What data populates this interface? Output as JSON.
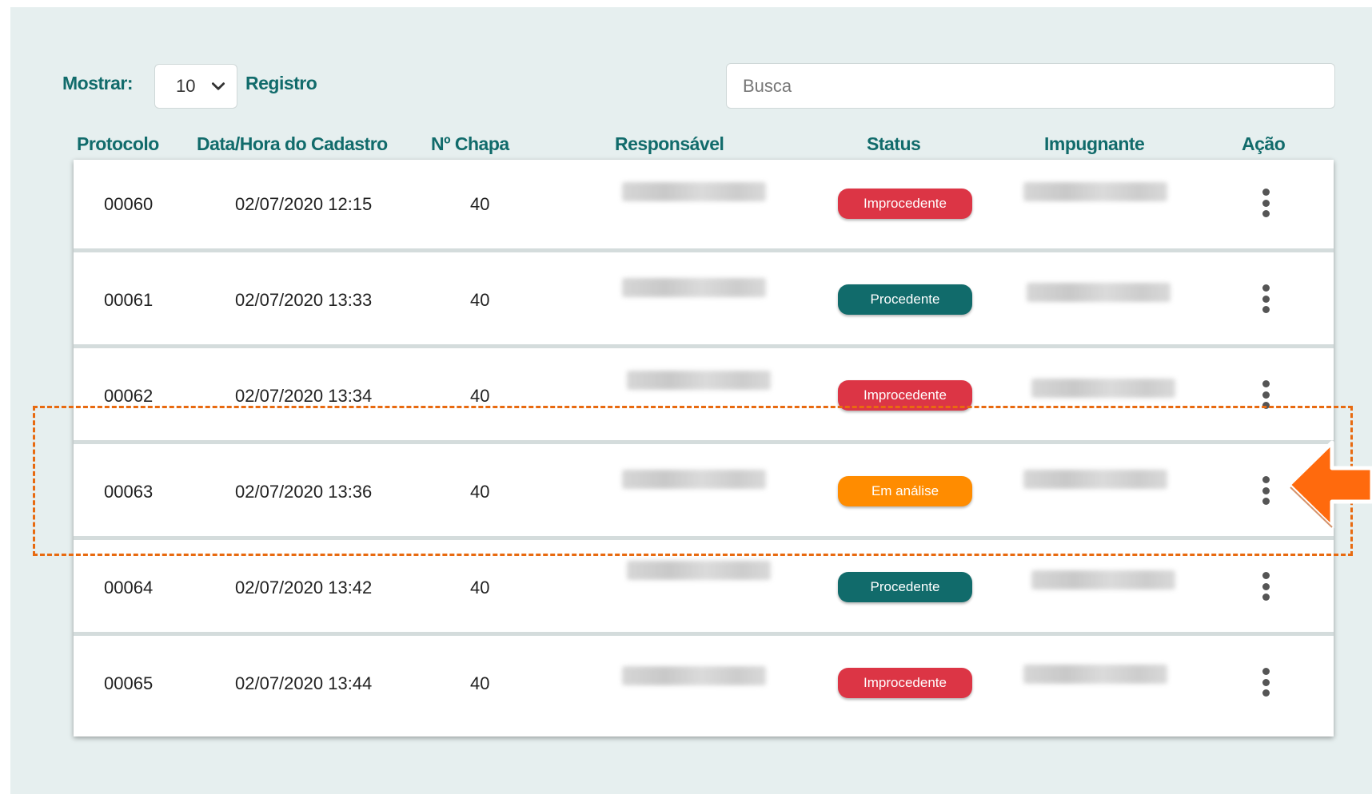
{
  "toolbar": {
    "show_label": "Mostrar:",
    "page_size": "10",
    "records_label": "Registro",
    "search_placeholder": "Busca"
  },
  "columns": {
    "protocolo": "Protocolo",
    "data_hora": "Data/Hora do Cadastro",
    "chapa": "Nº Chapa",
    "responsavel": "Responsável",
    "status": "Status",
    "impugnante": "Impugnante",
    "acao": "Ação"
  },
  "rows": [
    {
      "protocolo": "00060",
      "data_hora": "02/07/2020 12:15",
      "chapa": "40",
      "status": "Improcedente",
      "status_color": "#dc3545",
      "highlighted": false
    },
    {
      "protocolo": "00061",
      "data_hora": "02/07/2020 13:33",
      "chapa": "40",
      "status": "Procedente",
      "status_color": "#116b6b",
      "highlighted": false
    },
    {
      "protocolo": "00062",
      "data_hora": "02/07/2020 13:34",
      "chapa": "40",
      "status": "Improcedente",
      "status_color": "#dc3545",
      "highlighted": false
    },
    {
      "protocolo": "00063",
      "data_hora": "02/07/2020 13:36",
      "chapa": "40",
      "status": "Em análise",
      "status_color": "#ff8c00",
      "highlighted": true
    },
    {
      "protocolo": "00064",
      "data_hora": "02/07/2020 13:42",
      "chapa": "40",
      "status": "Procedente",
      "status_color": "#116b6b",
      "highlighted": false
    },
    {
      "protocolo": "00065",
      "data_hora": "02/07/2020 13:44",
      "chapa": "40",
      "status": "Improcedente",
      "status_color": "#dc3545",
      "highlighted": false
    }
  ],
  "icons": {
    "page_size_dropdown": "chevron-down-icon",
    "row_action": "kebab-menu-icon",
    "callout": "arrow-left-icon"
  },
  "colors": {
    "accent": "#116b6b",
    "panel_background": "#e6efef",
    "highlight": "#e86a10"
  }
}
